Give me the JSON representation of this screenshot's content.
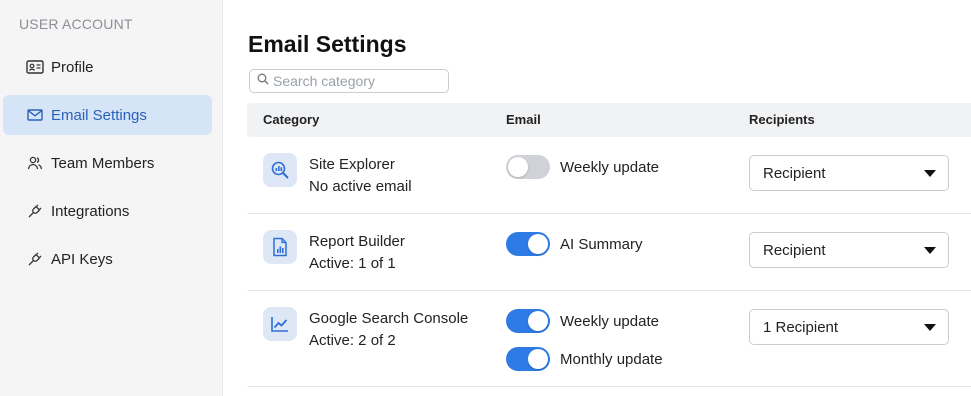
{
  "sidebar": {
    "heading": "USER ACCOUNT",
    "items": [
      {
        "label": "Profile",
        "icon": "id-card-icon",
        "active": false
      },
      {
        "label": "Email Settings",
        "icon": "mail-icon",
        "active": true
      },
      {
        "label": "Team Members",
        "icon": "users-icon",
        "active": false
      },
      {
        "label": "Integrations",
        "icon": "plug-icon",
        "active": false
      },
      {
        "label": "API Keys",
        "icon": "plug-icon",
        "active": false
      }
    ]
  },
  "main": {
    "title": "Email Settings",
    "search": {
      "placeholder": "Search category",
      "value": ""
    },
    "columns": {
      "category": "Category",
      "email": "Email",
      "recipients": "Recipients"
    },
    "rows": [
      {
        "name": "Site Explorer",
        "status": "No active email",
        "icon": "search-chart-icon",
        "emails": [
          {
            "label": "Weekly update",
            "enabled": false
          }
        ],
        "recipients": "Recipient"
      },
      {
        "name": "Report Builder",
        "status": "Active: 1 of 1",
        "icon": "report-icon",
        "emails": [
          {
            "label": "AI Summary",
            "enabled": true
          }
        ],
        "recipients": "Recipient"
      },
      {
        "name": "Google Search Console",
        "status": "Active: 2 of 2",
        "icon": "line-chart-icon",
        "emails": [
          {
            "label": "Weekly update",
            "enabled": true
          },
          {
            "label": "Monthly update",
            "enabled": true
          }
        ],
        "recipients": "1 Recipient"
      }
    ]
  },
  "colors": {
    "accent": "#2f7be5",
    "active_nav_bg": "#d6e4f7",
    "active_nav_text": "#2a62b8",
    "toggle_off": "#cfd2d6"
  }
}
